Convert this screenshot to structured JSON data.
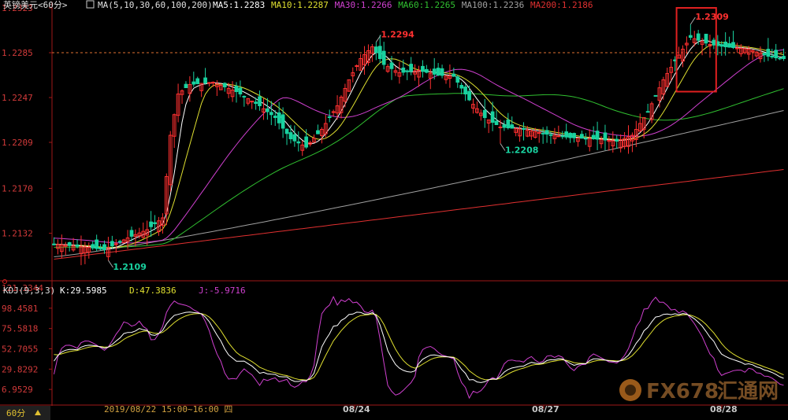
{
  "header": {
    "title": "英镑美元<60分>",
    "ma_params": "MA(5,10,30,60,100,200)",
    "ma_values": [
      {
        "label": "MA5:1.2283",
        "color": "#ffffff"
      },
      {
        "label": "MA10:1.2287",
        "color": "#e0e030"
      },
      {
        "label": "MA30:1.2266",
        "color": "#d040d0"
      },
      {
        "label": "MA60:1.2265",
        "color": "#30c030"
      },
      {
        "label": "MA100:1.2236",
        "color": "#a0a0a0"
      },
      {
        "label": "MA200:1.2186",
        "color": "#e03030"
      }
    ]
  },
  "kdj_header": {
    "params": "KDJ(9,3,3)",
    "k": "K:29.5985",
    "d": "D:47.3836",
    "j": "J:-5.9716"
  },
  "footer": {
    "period": "60分",
    "cursor_time": "2019/08/22 15:00~16:00 四",
    "dates": [
      "08/24",
      "08/27",
      "08/28"
    ]
  },
  "watermark": {
    "text": "FX678",
    "cn": "汇通网"
  },
  "colors": {
    "up": "#ff3030",
    "down": "#19d2a0",
    "axis": "#a01818",
    "k": "#ffffff",
    "d": "#e0e030",
    "j": "#d040d0",
    "ma5": "#ffffff",
    "ma10": "#e0e030",
    "ma30": "#d040d0",
    "ma60": "#30c030",
    "ma100": "#a0a0a0",
    "ma200": "#e03030"
  },
  "chart_data": [
    {
      "type": "candlestick",
      "y_ticks": [
        "1.2323",
        "1.2285",
        "1.2247",
        "1.2209",
        "1.2170",
        "1.2132"
      ],
      "ylim": [
        1.2095,
        1.2323
      ],
      "reference_line": 1.2285,
      "annotations": [
        {
          "label": "1.2109",
          "index": 14,
          "value": 1.2109,
          "color": "#19d2a0",
          "pos": "below"
        },
        {
          "label": "1.2294",
          "index": 83,
          "value": 1.2294,
          "color": "#ff3030",
          "pos": "above"
        },
        {
          "label": "1.2208",
          "index": 115,
          "value": 1.2208,
          "color": "#19d2a0",
          "pos": "below"
        },
        {
          "label": "1.2309",
          "index": 164,
          "value": 1.2309,
          "color": "#ff3030",
          "pos": "above"
        }
      ],
      "highlight_range": [
        161,
        170
      ]
    },
    {
      "type": "line",
      "title": "KDJ(9,3,3)",
      "y_ticks": [
        "121.3344",
        "98.4581",
        "75.5818",
        "52.7055",
        "29.8292",
        "6.9529"
      ],
      "ylim": [
        -8,
        121.3344
      ]
    }
  ]
}
